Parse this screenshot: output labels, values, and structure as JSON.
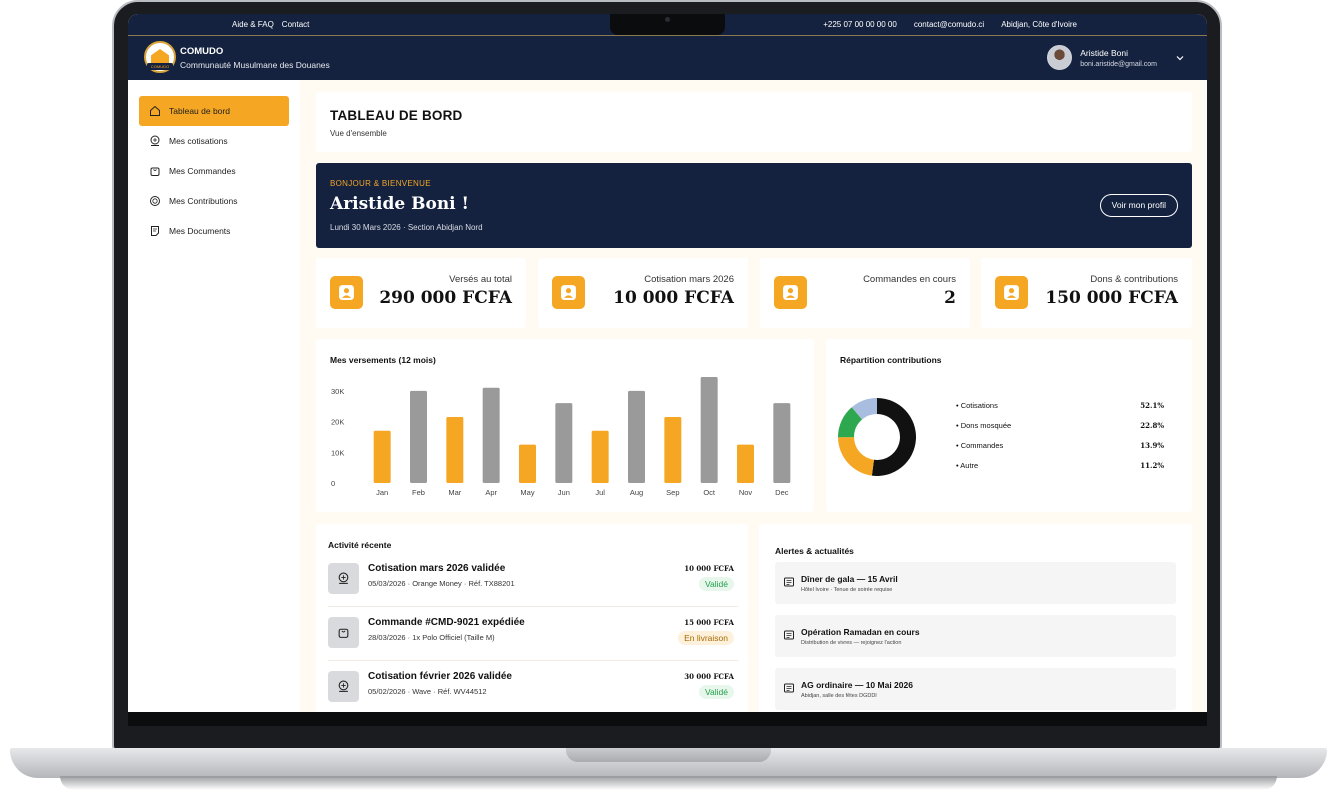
{
  "topbar": {
    "help": "Aide & FAQ",
    "contact": "Contact",
    "phone": "+225 07 00 00 00 00",
    "email": "contact@comudo.ci",
    "location": "Abidjan,  Côte d'Ivoire"
  },
  "header": {
    "logo_text": "COMUDO",
    "brand_name": "COMUDO",
    "brand_sub": "Communauté Musulmane des Douanes",
    "user_name": "Aristide Boni",
    "user_email": "boni.aristide@gmail.com"
  },
  "sidebar": {
    "items": [
      {
        "label": "Tableau de bord",
        "icon": "home-icon"
      },
      {
        "label": "Mes cotisations",
        "icon": "coins-icon"
      },
      {
        "label": "Mes Commandes",
        "icon": "bag-icon"
      },
      {
        "label": "Mes Contributions",
        "icon": "coin-icon"
      },
      {
        "label": "Mes Documents",
        "icon": "document-icon"
      }
    ]
  },
  "page": {
    "title": "TABLEAU DE BORD",
    "subtitle": "Vue d'ensemble"
  },
  "welcome": {
    "kicker": "BONJOUR & BIENVENUE",
    "name": "Aristide Boni !",
    "date": "Lundi 30 Mars 2026 · Section Abidjan Nord",
    "button": "Voir mon profil"
  },
  "stats": [
    {
      "label": "Versés au total",
      "value": "290 000 FCFA"
    },
    {
      "label": "Cotisation mars 2026",
      "value": "10 000 FCFA"
    },
    {
      "label": "Commandes en cours",
      "value": "2"
    },
    {
      "label": "Dons & contributions",
      "value": "150 000 FCFA"
    }
  ],
  "colors": {
    "navy": "#14223f",
    "accent": "#f5a623",
    "gray_bar": "#9a9a9a",
    "pie_black": "#111111",
    "pie_orange": "#f5a623",
    "pie_green": "#2ea84f",
    "pie_blue": "#a9bde0"
  },
  "chart_data": [
    {
      "type": "bar",
      "title": "Mes versements (12 mois)",
      "categories": [
        "Jan",
        "Feb",
        "Mar",
        "Apr",
        "May",
        "Jun",
        "Jul",
        "Aug",
        "Sep",
        "Oct",
        "Nov",
        "Dec"
      ],
      "values": [
        17000,
        30000,
        21500,
        31000,
        12500,
        26000,
        17000,
        30000,
        21500,
        34500,
        12500,
        26000
      ],
      "colors": [
        "#f5a623",
        "#9a9a9a",
        "#f5a623",
        "#9a9a9a",
        "#f5a623",
        "#9a9a9a",
        "#f5a623",
        "#9a9a9a",
        "#f5a623",
        "#9a9a9a",
        "#f5a623",
        "#9a9a9a"
      ],
      "ylim": [
        0,
        34500
      ],
      "yticks": [
        0,
        10000,
        20000,
        30000
      ],
      "ytick_labels": [
        "0",
        "10K",
        "20K",
        "30K"
      ],
      "grid": false
    },
    {
      "type": "pie",
      "title": "Répartition contributions",
      "labels": [
        "Cotisations",
        "Dons mosquée",
        "Commandes",
        "Autre"
      ],
      "values": [
        52.1,
        22.8,
        13.9,
        11.2
      ],
      "value_labels": [
        "52.1%",
        "22.8%",
        "13.9%",
        "11.2%"
      ],
      "colors": [
        "#111111",
        "#f5a623",
        "#2ea84f",
        "#a9bde0"
      ],
      "donut": true
    }
  ],
  "activity": {
    "title": "Activité récente",
    "rows": [
      {
        "title": "Cotisation mars 2026 validée",
        "detail": "05/03/2026 · Orange Money · Réf. TX88201",
        "amount": "10 000 FCFA",
        "status": "Validé",
        "icon": "coins-icon"
      },
      {
        "title": "Commande #CMD-9021 expédiée",
        "detail": "28/03/2026 · 1x Polo Officiel (Taille M)",
        "amount": "15 000 FCFA",
        "status": "En livraison",
        "icon": "bag-icon"
      },
      {
        "title": "Cotisation février 2026 validée",
        "detail": "05/02/2026 · Wave · Réf. WV44512",
        "amount": "30 000 FCFA",
        "status": "Validé",
        "icon": "coins-icon"
      }
    ]
  },
  "alerts": {
    "title": "Alertes & actualités",
    "items": [
      {
        "title": "Dîner de gala — 15 Avril",
        "detail": "Hôtel Ivoire · Tenue de soirée requise"
      },
      {
        "title": "Opération Ramadan en cours",
        "detail": "Distribution de vivres — rejoignez l'action"
      },
      {
        "title": "AG ordinaire — 10 Mai 2026",
        "detail": "Abidjan, salle des fêtes DGDDI"
      }
    ]
  }
}
